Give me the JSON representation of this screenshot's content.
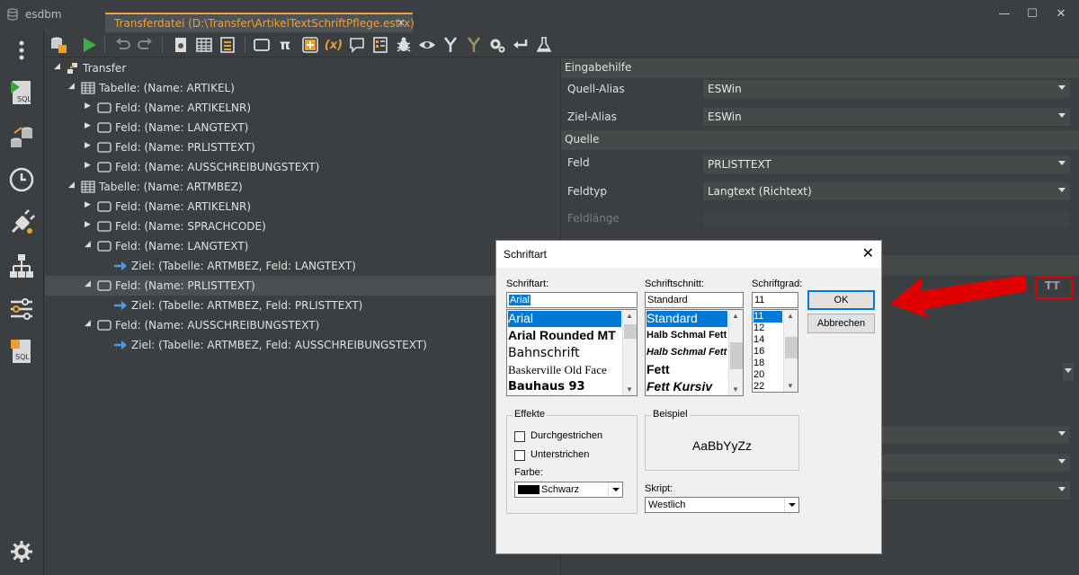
{
  "app": {
    "name": "esdbm"
  },
  "tab": {
    "title": "Transferdatei (D:\\Transfer\\ArtikelTextSchriftPflege.estrx)",
    "close": "×"
  },
  "window": {
    "minimize": "—",
    "maximize": "☐",
    "close": "✕"
  },
  "toolbar": {
    "pi_label": "π",
    "x_label": "(x)"
  },
  "tree": {
    "rows": [
      {
        "label": "Transfer"
      },
      {
        "label": "Tabelle: (Name: ARTIKEL)"
      },
      {
        "label": "Feld: (Name: ARTIKELNR)"
      },
      {
        "label": "Feld: (Name: LANGTEXT)"
      },
      {
        "label": "Feld: (Name: PRLISTTEXT)"
      },
      {
        "label": "Feld: (Name: AUSSCHREIBUNGSTEXT)"
      },
      {
        "label": "Tabelle: (Name: ARTMBEZ)"
      },
      {
        "label": "Feld: (Name: ARTIKELNR)"
      },
      {
        "label": "Feld: (Name: SPRACHCODE)"
      },
      {
        "label": "Feld: (Name: LANGTEXT)"
      },
      {
        "label": "Ziel: (Tabelle: ARTMBEZ, Feld: LANGTEXT)"
      },
      {
        "label": "Feld: (Name: PRLISTTEXT)"
      },
      {
        "label": "Ziel: (Tabelle: ARTMBEZ, Feld: PRLISTTEXT)"
      },
      {
        "label": "Feld: (Name: AUSSCHREIBUNGSTEXT)"
      },
      {
        "label": "Ziel: (Tabelle: ARTMBEZ, Feld: AUSSCHREIBUNGSTEXT)"
      }
    ]
  },
  "props": {
    "sections": {
      "eingabehilfe": "Eingabehilfe",
      "quelle": "Quelle"
    },
    "quell_alias": {
      "label": "Quell-Alias",
      "value": "ESWin"
    },
    "ziel_alias": {
      "label": "Ziel-Alias",
      "value": "ESWin"
    },
    "feld": {
      "label": "Feld",
      "value": "PRLISTTEXT"
    },
    "feldtyp": {
      "label": "Feldtyp",
      "value": "Langtext (Richtext)"
    },
    "feldlaenge": {
      "label": "Feldlänge"
    },
    "font_button_icon": "TT"
  },
  "dialog": {
    "title": "Schriftart",
    "close": "✕",
    "schriftart_label": "Schriftart:",
    "schriftart_value": "Arial",
    "fonts": [
      "Arial",
      "Arial Rounded MT",
      "Bahnschrift",
      "Baskerville Old Face",
      "Bauhaus 93"
    ],
    "schriftschnitt_label": "Schriftschnitt:",
    "schriftschnitt_value": "Standard",
    "styles": [
      "Standard",
      "Halb Schmal Fett",
      "Halb Schmal Fett",
      "Fett",
      "Fett Kursiv"
    ],
    "schriftgrad_label": "Schriftgrad:",
    "schriftgrad_value": "11",
    "sizes": [
      "11",
      "12",
      "14",
      "16",
      "18",
      "20",
      "22"
    ],
    "ok": "OK",
    "abbrechen": "Abbrechen",
    "effekte_label": "Effekte",
    "durchgestrichen": "Durchgestrichen",
    "unterstrichen": "Unterstrichen",
    "farbe_label": "Farbe:",
    "farbe_value": "Schwarz",
    "beispiel_label": "Beispiel",
    "beispiel_text": "AaBbYyZz",
    "skript_label": "Skript:",
    "skript_value": "Westlich"
  },
  "colors": {
    "accent": "#f0a030",
    "selection": "#0078d7",
    "highlight": "#e00000"
  }
}
